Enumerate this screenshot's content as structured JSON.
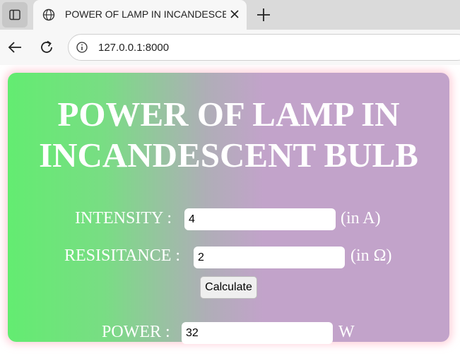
{
  "browser": {
    "tab_title": "POWER OF LAMP IN INCANDESCENT BULB",
    "url": "127.0.0.1:8000"
  },
  "page": {
    "title": "POWER OF LAMP IN INCANDESCENT BULB",
    "intensity": {
      "label": "INTENSITY :",
      "value": "4",
      "unit": "(in A)"
    },
    "resistance": {
      "label": "RESISITANCE :",
      "value": "2",
      "unit": "(in Ω)"
    },
    "calculate_label": "Calculate",
    "power": {
      "label": "POWER :",
      "value": "32",
      "unit": "W"
    }
  },
  "colors": {
    "gradient_start": "#63ec71",
    "gradient_end": "#c2a3ca",
    "glow": "#ffb9c8"
  }
}
